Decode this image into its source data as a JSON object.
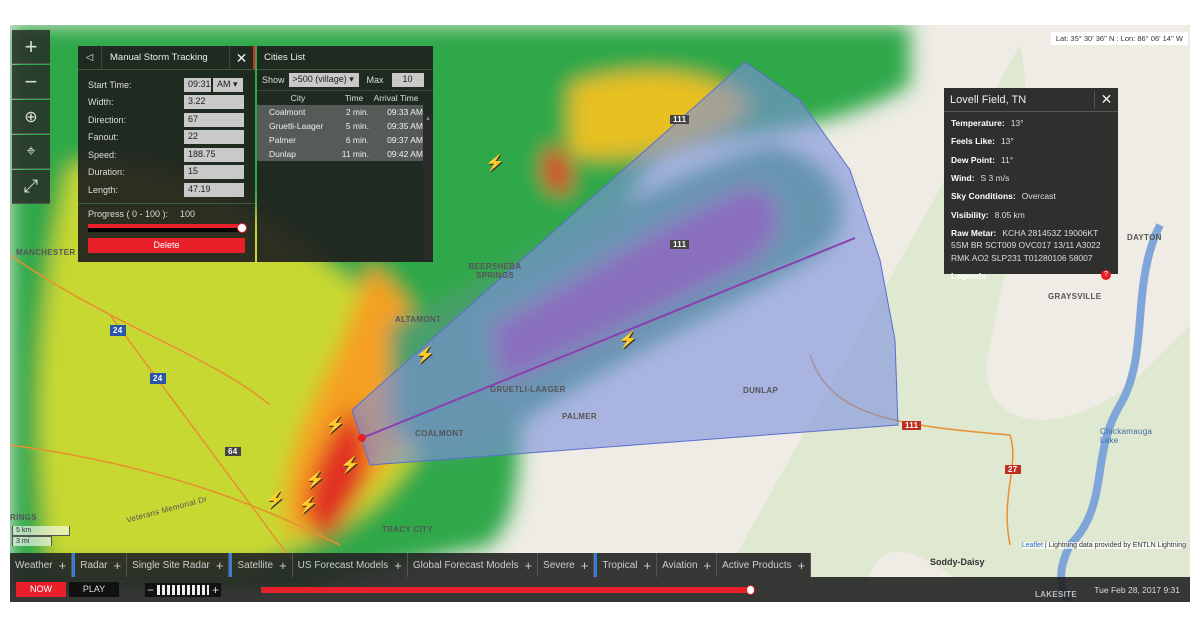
{
  "coords": "Lat: 35° 30' 36'' N : Lon: 86° 06' 14'' W",
  "controls": [
    "zoom-in",
    "zoom-out",
    "zoom-search",
    "location",
    "fullscreen"
  ],
  "storm_panel": {
    "title": "Manual Storm Tracking",
    "fields": [
      {
        "label": "Start Time:",
        "value": "09:31",
        "ampm": "AM"
      },
      {
        "label": "Width:",
        "value": "3.22"
      },
      {
        "label": "Direction:",
        "value": "67"
      },
      {
        "label": "Fanout:",
        "value": "22"
      },
      {
        "label": "Speed:",
        "value": "188.75"
      },
      {
        "label": "Duration:",
        "value": "15"
      },
      {
        "label": "Length:",
        "value": "47.19"
      }
    ],
    "progress_label": "Progress ( 0 - 100 ):",
    "progress_value": "100",
    "progress": 100,
    "delete": "Delete"
  },
  "cities_panel": {
    "title": "Cities List",
    "show_label": "Show",
    "show_value": ">500 (village)",
    "max_label": "Max",
    "max_value": "10",
    "columns": [
      "City",
      "Time",
      "Arrival Time"
    ],
    "rows": [
      [
        "Coalmont",
        "2 min.",
        "09:33 AM"
      ],
      [
        "Gruetli-Laager",
        "5 min.",
        "09:35 AM"
      ],
      [
        "Palmer",
        "6 min.",
        "09:37 AM"
      ],
      [
        "Dunlap",
        "11 min.",
        "09:42 AM"
      ]
    ]
  },
  "station": {
    "title": "Lovell Field, TN",
    "rows": [
      {
        "k": "Temperature:",
        "v": "13°"
      },
      {
        "k": "Feels Like:",
        "v": "13°"
      },
      {
        "k": "Dew Point:",
        "v": "11°"
      },
      {
        "k": "Wind:",
        "v": "S 3 m/s"
      },
      {
        "k": "Sky Conditions:",
        "v": "Overcast"
      },
      {
        "k": "Visibility:",
        "v": "8.05 km"
      },
      {
        "k": "Raw Metar:",
        "v": "KCHA 281453Z 19006KT 5SM BR SCT009 OVC017 13/11 A3022 RMK AO2 SLP231 T01280106 58007"
      }
    ],
    "legends": "Legends"
  },
  "map_labels": {
    "manchester": "MANCHESTER",
    "beersheba": "BEERSHEBA SPRINGS",
    "altamont": "ALTAMONT",
    "gruetli": "GRUETLI-LAAGER",
    "palmer": "PALMER",
    "coalmont": "COALMONT",
    "dunlap": "DUNLAP",
    "tracy": "TRACY CITY",
    "dayton": "DAYTON",
    "graysville": "GRAYSVILLE",
    "chickamauga": "Chickamauga Lake",
    "soddy": "Soddy-Daisy",
    "lakesite": "LAKESITE",
    "veterans": "Veterans Memorial Dr",
    "rings": "RINGS",
    "i24a": "24",
    "i24b": "24",
    "r111a": "111",
    "r111b": "111",
    "r111c": "111",
    "r64": "64",
    "r27": "27"
  },
  "scale": {
    "km": "5 km",
    "mi": "3 mi"
  },
  "attribution": {
    "leaflet": "Leaflet",
    "text": " | Lightning data provided by ENTLN Lightning"
  },
  "tabs": [
    "Weather",
    "Radar",
    "Single Site Radar",
    "Satellite",
    "US Forecast Models",
    "Global Forecast Models",
    "Severe",
    "Tropical",
    "Aviation",
    "Active Products"
  ],
  "bottom": {
    "now": "NOW",
    "play": "PLAY",
    "timeline_progress": 100,
    "datetime": "Tue Feb 28, 2017 9:31"
  },
  "colors": {
    "accent": "#e8202a",
    "cone": "#7c8fe0",
    "track": "#8a3fb0"
  }
}
